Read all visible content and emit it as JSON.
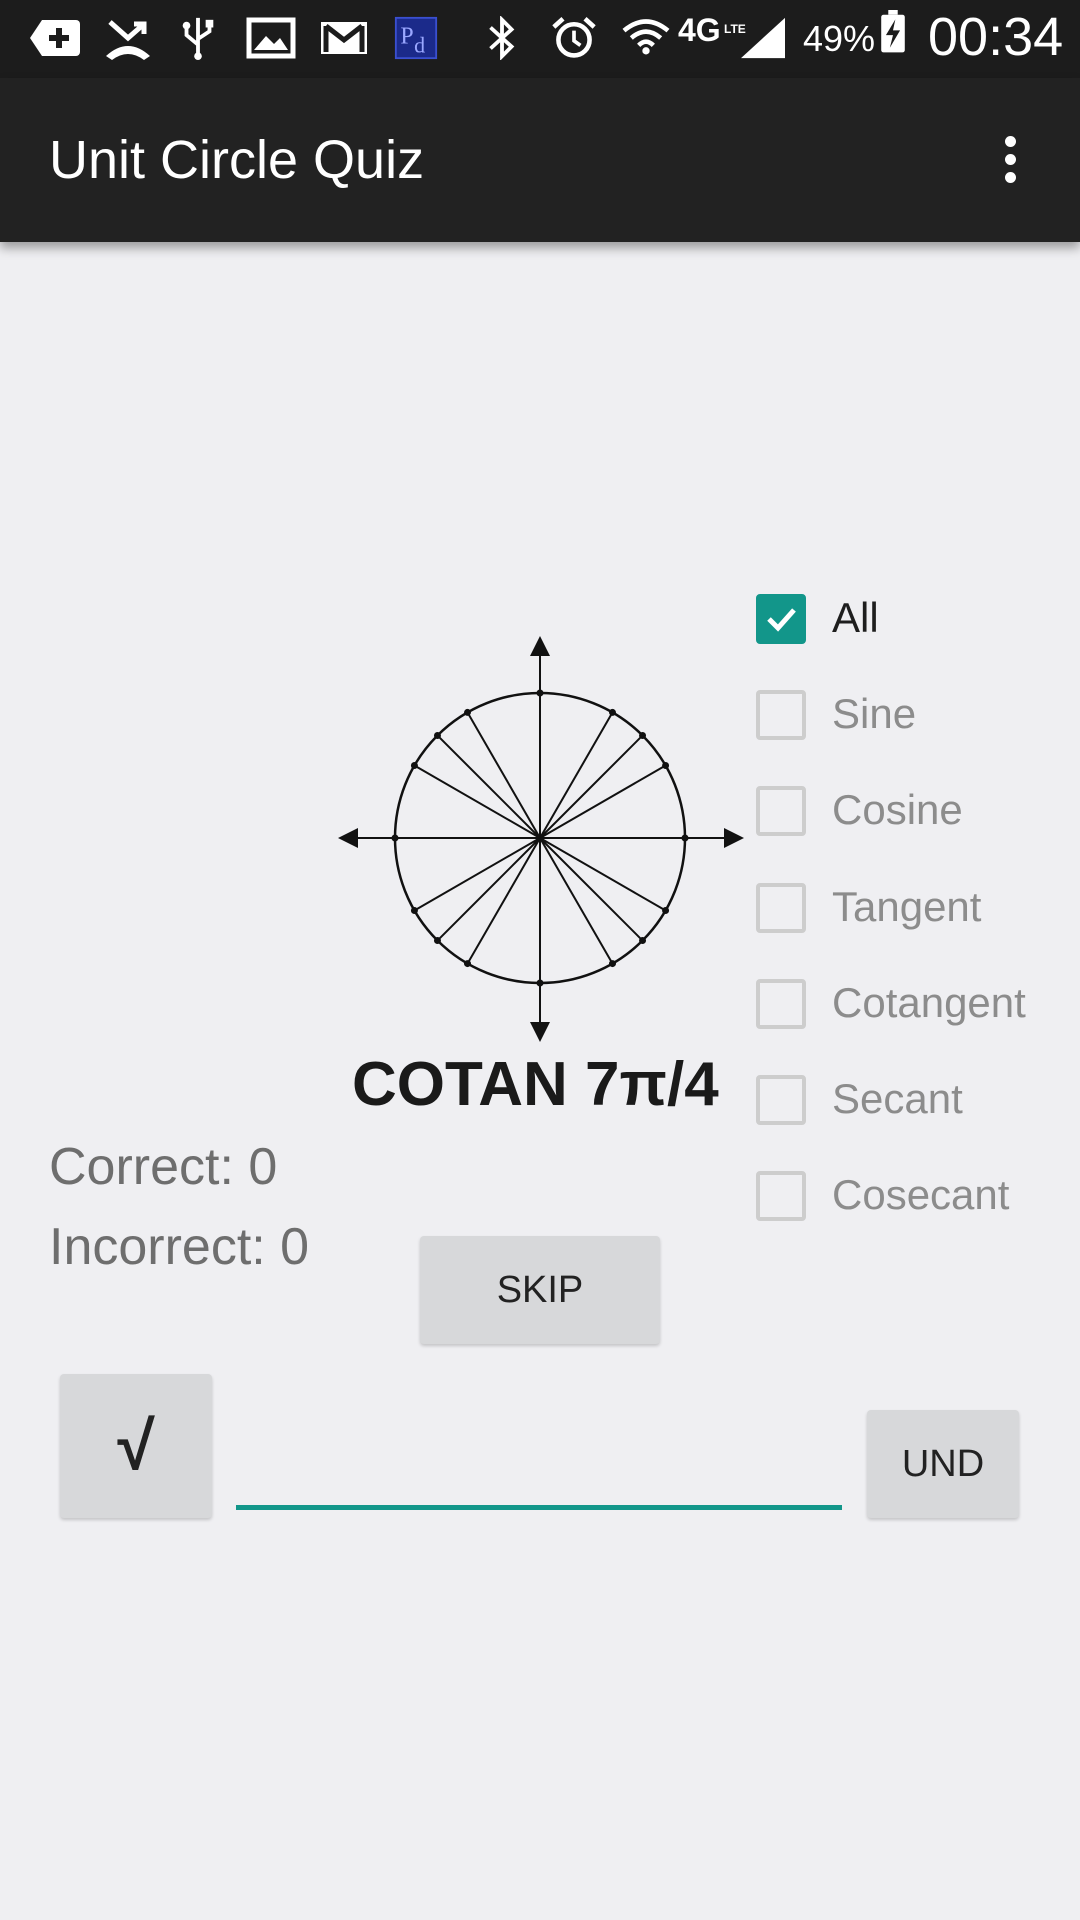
{
  "status_bar": {
    "battery_percent": "49%",
    "time": "00:34",
    "network_label": "4G",
    "network_sublabel": "LTE",
    "icons": [
      "add-box-icon",
      "missed-call-icon",
      "usb-icon",
      "image-icon",
      "gmail-icon",
      "pd-app-icon",
      "bluetooth-icon",
      "alarm-icon",
      "wifi-icon",
      "cell-signal-icon",
      "battery-charging-icon"
    ]
  },
  "app_bar": {
    "title": "Unit Circle Quiz",
    "overflow_icon": "more-vert-icon"
  },
  "quiz": {
    "question": "COTAN 7π/4",
    "correct": "Correct: 0",
    "incorrect": "Incorrect: 0"
  },
  "filters": [
    {
      "label": "All",
      "checked": true
    },
    {
      "label": "Sine",
      "checked": false
    },
    {
      "label": "Cosine",
      "checked": false
    },
    {
      "label": "Tangent",
      "checked": false
    },
    {
      "label": "Cotangent",
      "checked": false
    },
    {
      "label": "Secant",
      "checked": false
    },
    {
      "label": "Cosecant",
      "checked": false
    }
  ],
  "controls": {
    "skip_label": "SKIP",
    "sqrt_label": "√",
    "und_label": "UND",
    "answer_value": ""
  },
  "colors": {
    "accent": "#12968a",
    "appbar": "#222222",
    "statusbar": "#1c1c1c",
    "background": "#efeff2"
  }
}
